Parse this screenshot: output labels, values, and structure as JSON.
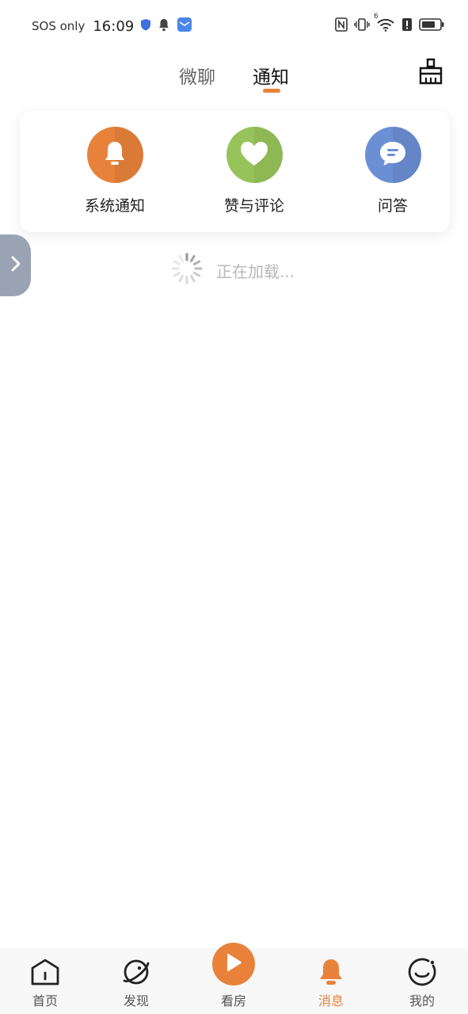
{
  "status_bar": {
    "carrier": "SOS only",
    "time": "16:09",
    "icons": [
      "shield-icon",
      "bell-icon",
      "mail-app-icon",
      "nfc-icon",
      "vibrate-icon",
      "wifi-icon",
      "alert-icon",
      "battery-icon"
    ],
    "wifi_badge": "6"
  },
  "header": {
    "tabs": [
      {
        "label": "微聊",
        "active": false
      },
      {
        "label": "通知",
        "active": true
      }
    ],
    "clean_icon": "broom-icon"
  },
  "card": {
    "items": [
      {
        "label": "系统通知",
        "icon": "bell-icon",
        "color": "#e8823a"
      },
      {
        "label": "赞与评论",
        "icon": "heart-icon",
        "color": "#96c45a"
      },
      {
        "label": "问答",
        "icon": "chat-bubble-icon",
        "color": "#6b8fd4"
      }
    ]
  },
  "loading": {
    "text": "正在加载..."
  },
  "bottom_nav": {
    "items": [
      {
        "label": "首页",
        "icon": "home-icon",
        "active": false
      },
      {
        "label": "发现",
        "icon": "planet-icon",
        "active": false
      },
      {
        "label": "看房",
        "icon": "play-icon",
        "active": false
      },
      {
        "label": "消息",
        "icon": "bell-icon",
        "active": true
      },
      {
        "label": "我的",
        "icon": "smile-icon",
        "active": false
      }
    ],
    "active_color": "#e8823a"
  }
}
